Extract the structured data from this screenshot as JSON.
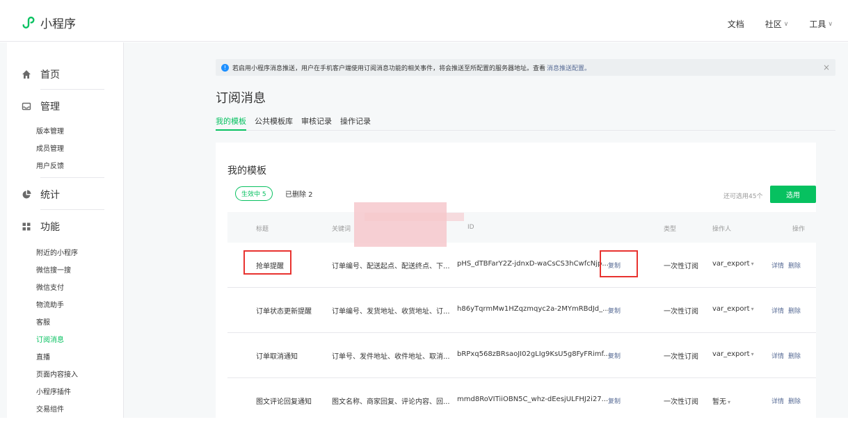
{
  "app": {
    "name": "小程序"
  },
  "topnav": [
    {
      "label": "文档",
      "dropdown": ""
    },
    {
      "label": "社区",
      "dropdown": "∨"
    },
    {
      "label": "工具",
      "dropdown": "∨"
    }
  ],
  "sidebar": {
    "home": "首页",
    "manage": "管理",
    "manage_items": [
      "版本管理",
      "成员管理",
      "用户反馈"
    ],
    "stats": "统计",
    "features": "功能",
    "feature_items": [
      "附近的小程序",
      "微信搜一搜",
      "微信支付",
      "物流助手",
      "客服",
      "订阅消息",
      "直播",
      "页面内容接入",
      "小程序插件",
      "交易组件"
    ]
  },
  "notice": {
    "icon": "!",
    "text": "若启用小程序消息推送，用户在手机客户端使用订阅消息功能的相关事件，将会推送至所配置的服务器地址。查看",
    "link": "消息推送配置。",
    "close": "×"
  },
  "page": {
    "title": "订阅消息"
  },
  "tabs": [
    {
      "label": "我的模板",
      "active": true
    },
    {
      "label": "公共模板库",
      "active": false
    },
    {
      "label": "审核记录",
      "active": false
    },
    {
      "label": "操作记录",
      "active": false
    }
  ],
  "panel": {
    "title": "我的模板",
    "status_active": "生效中 5",
    "status_deleted": "已删除 2",
    "remaining": "还可选用45个",
    "select_button": "选用"
  },
  "table": {
    "headers": {
      "title": "标题",
      "keywords": "关键词",
      "id": "ID",
      "type": "类型",
      "operator": "操作人",
      "action": "操作"
    },
    "copy_label": "复制",
    "detail_label": "详情",
    "delete_label": "删除",
    "dropdown_glyph": "▾",
    "rows": [
      {
        "title": "抢单提醒",
        "keywords": "订单编号、配送起点、配送终点、下...",
        "id": "pHS_dTBFarY2Z-jdnxD-waCsCS3hCwfcNjp...",
        "type": "一次性订阅",
        "operator": "var_export"
      },
      {
        "title": "订单状态更新提醒",
        "keywords": "订单编号、发货地址、收货地址、订...",
        "id": "h86yTqrmMw1HZqzmqyc2a-2MYmRBdJd_...",
        "type": "一次性订阅",
        "operator": "var_export"
      },
      {
        "title": "订单取消通知",
        "keywords": "订单号、发件地址、收件地址、取消...",
        "id": "bRPxq568zBRsaoJI02gLIg9KsU5g8FyFRimf...",
        "type": "一次性订阅",
        "operator": "var_export"
      },
      {
        "title": "图文评论回复通知",
        "keywords": "图文名称、商家回复、评论内容、回...",
        "id": "mmd8RoVITiiOBN5C_whz-dEesjULFHJ2i27...",
        "type": "一次性订阅",
        "operator": "暂无"
      }
    ]
  },
  "colors": {
    "accent": "#07c160",
    "link": "#576b95",
    "highlight": "#e8322f",
    "info": "#1e90ff"
  }
}
